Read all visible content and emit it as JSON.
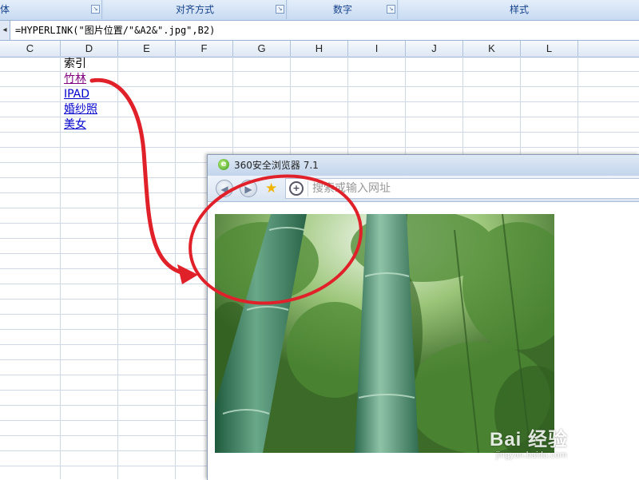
{
  "ribbon": {
    "groups": [
      {
        "label": "体"
      },
      {
        "label": "对齐方式"
      },
      {
        "label": "数字"
      },
      {
        "label": "样式"
      }
    ]
  },
  "formula_bar": {
    "formula": "=HYPERLINK(\"图片位置/\"&A2&\".jpg\",B2)"
  },
  "columns": [
    "C",
    "D",
    "E",
    "F",
    "G",
    "H",
    "I",
    "J",
    "K",
    "L"
  ],
  "cells": {
    "header": "索引",
    "links": [
      "竹林",
      "IPAD",
      "婚纱照",
      "美女"
    ]
  },
  "browser": {
    "title": "360安全浏览器 7.1",
    "address_placeholder": "搜索或输入网址",
    "image_alt": "竹林"
  },
  "watermark": {
    "brand": "Bai 经验",
    "url": "jingyan.baidu.com"
  },
  "colors": {
    "annotation_red": "#e0212a",
    "link_blue": "#0000cc",
    "link_visited": "#800080",
    "ribbon_text": "#15428b"
  }
}
